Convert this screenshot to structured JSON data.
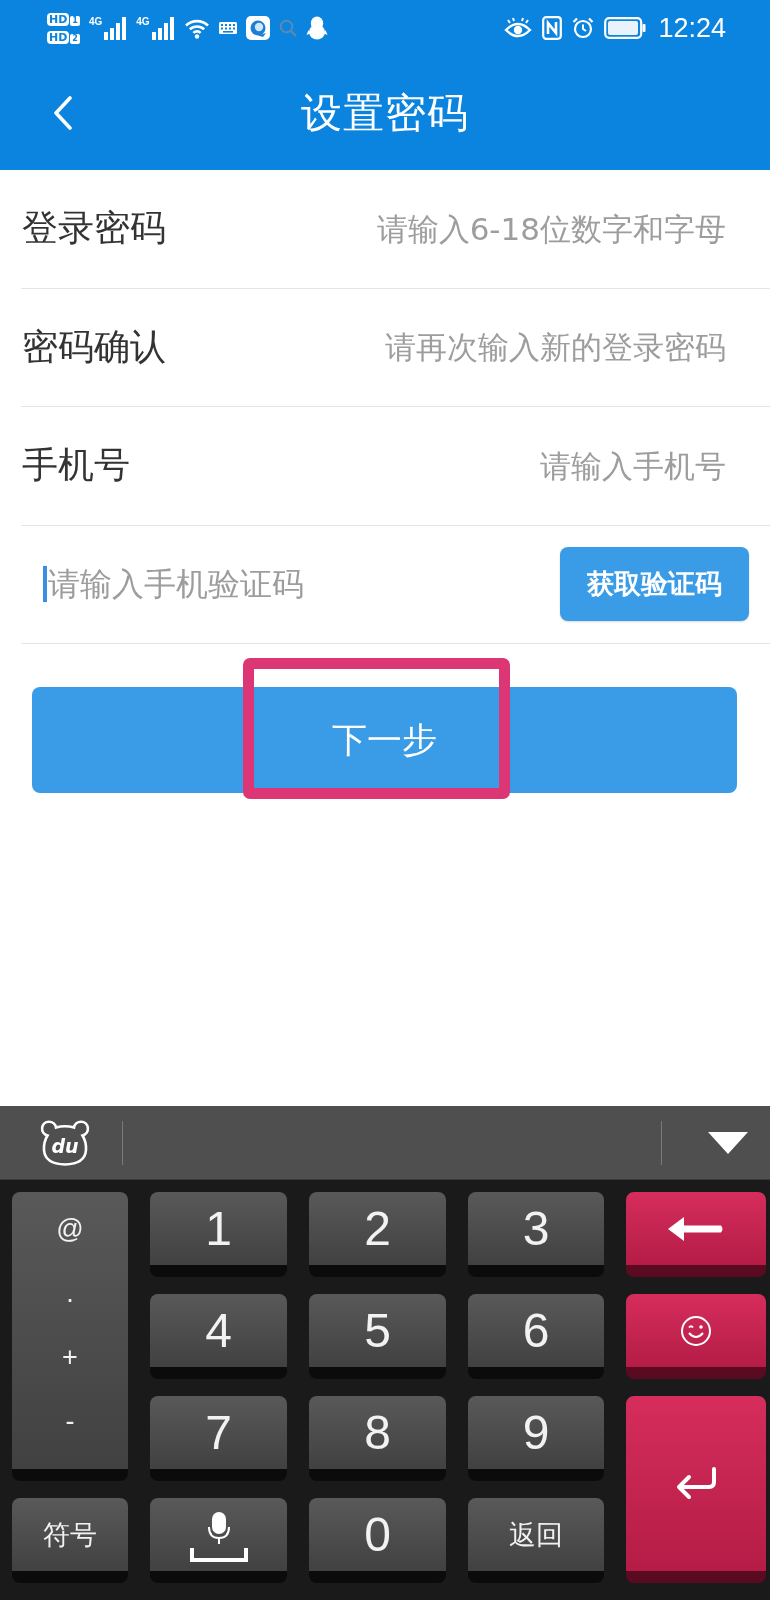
{
  "status_bar": {
    "sim_badges": [
      {
        "label": "HD",
        "slot": "1"
      },
      {
        "label": "HD",
        "slot": "2"
      }
    ],
    "networks": [
      {
        "label": "4G"
      },
      {
        "label": "4G"
      }
    ],
    "time": "12:24"
  },
  "header": {
    "title": "设置密码"
  },
  "form": {
    "rows": [
      {
        "kind": "field",
        "label": "登录密码",
        "placeholder": "请输入6-18位数字和字母"
      },
      {
        "kind": "field",
        "label": "密码确认",
        "placeholder": "请再次输入新的登录密码"
      },
      {
        "kind": "field",
        "label": "手机号",
        "placeholder": "请输入手机号"
      },
      {
        "kind": "code",
        "placeholder": "请输入手机验证码",
        "focused": true,
        "button": "获取验证码"
      }
    ]
  },
  "next_button": {
    "label": "下一步",
    "highlighted": true
  },
  "keyboard": {
    "logo": "du",
    "keys": [
      {
        "kind": "symbols",
        "labels": [
          "@",
          ".",
          "+",
          "-"
        ]
      },
      {
        "kind": "digit",
        "label": "1"
      },
      {
        "kind": "digit",
        "label": "2"
      },
      {
        "kind": "digit",
        "label": "3"
      },
      {
        "kind": "backspace"
      },
      {
        "kind": "digit",
        "label": "4"
      },
      {
        "kind": "digit",
        "label": "5"
      },
      {
        "kind": "digit",
        "label": "6"
      },
      {
        "kind": "emoji"
      },
      {
        "kind": "digit",
        "label": "7"
      },
      {
        "kind": "digit",
        "label": "8"
      },
      {
        "kind": "digit",
        "label": "9"
      },
      {
        "kind": "enter"
      },
      {
        "kind": "label",
        "label": "符号"
      },
      {
        "kind": "voice"
      },
      {
        "kind": "digit",
        "label": "0"
      },
      {
        "kind": "label",
        "label": "返回"
      }
    ]
  }
}
